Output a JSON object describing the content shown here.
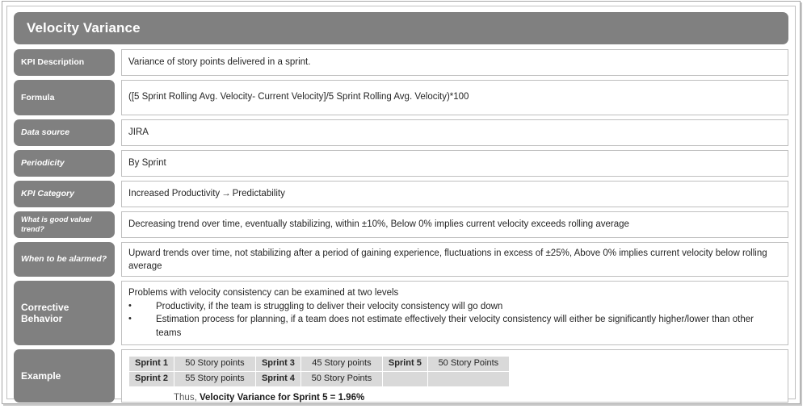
{
  "header": {
    "title": "Velocity Variance"
  },
  "rows": [
    {
      "label": "KPI Description",
      "value": "Variance of story points delivered in a sprint."
    },
    {
      "label": "Formula",
      "value": "([5 Sprint Rolling Avg. Velocity- Current Velocity]/5 Sprint Rolling Avg. Velocity)*100"
    },
    {
      "label": "Data source",
      "value": "JIRA"
    },
    {
      "label": "Periodicity",
      "value": "By Sprint"
    },
    {
      "label": "KPI Category",
      "value_before_arrow": "Increased Productivity",
      "arrow": "→",
      "value_after_arrow": "Predictability"
    },
    {
      "label": "What is good value/ trend?",
      "value": "Decreasing trend over time, eventually stabilizing, within ±10%, Below 0% implies current velocity exceeds rolling average"
    },
    {
      "label": "When to be alarmed?",
      "value": "Upward trends over time, not stabilizing after a period of gaining experience, fluctuations in excess of ±25%, Above 0% implies current velocity below rolling average"
    }
  ],
  "corrective": {
    "label": "Corrective Behavior",
    "lead": "Problems with velocity consistency can be examined at two levels",
    "bullet_marker": "•",
    "bullets": [
      "Productivity, if the team is struggling to deliver their velocity consistency  will go down",
      "Estimation process for planning, if a team does not estimate effectively their velocity consistency will either be significantly higher/lower than other teams"
    ]
  },
  "example": {
    "label": "Example",
    "table_rows": [
      [
        {
          "name": "Sprint 1",
          "points": "50 Story points"
        },
        {
          "name": "Sprint 3",
          "points": "45 Story points"
        },
        {
          "name": "Sprint 5",
          "points": "50 Story Points"
        }
      ],
      [
        {
          "name": "Sprint 2",
          "points": "55 Story points"
        },
        {
          "name": "Sprint 4",
          "points": "50 Story Points"
        },
        {
          "name": "",
          "points": ""
        }
      ]
    ],
    "conclusion_prefix": "Thus,",
    "conclusion_bold": "Velocity Variance for Sprint 5 = 1.96%"
  },
  "colors": {
    "label_gray": "#808080",
    "cell_border": "#bfbfbf",
    "table_cell_gray": "#d9d9d9",
    "text": "#262626"
  }
}
